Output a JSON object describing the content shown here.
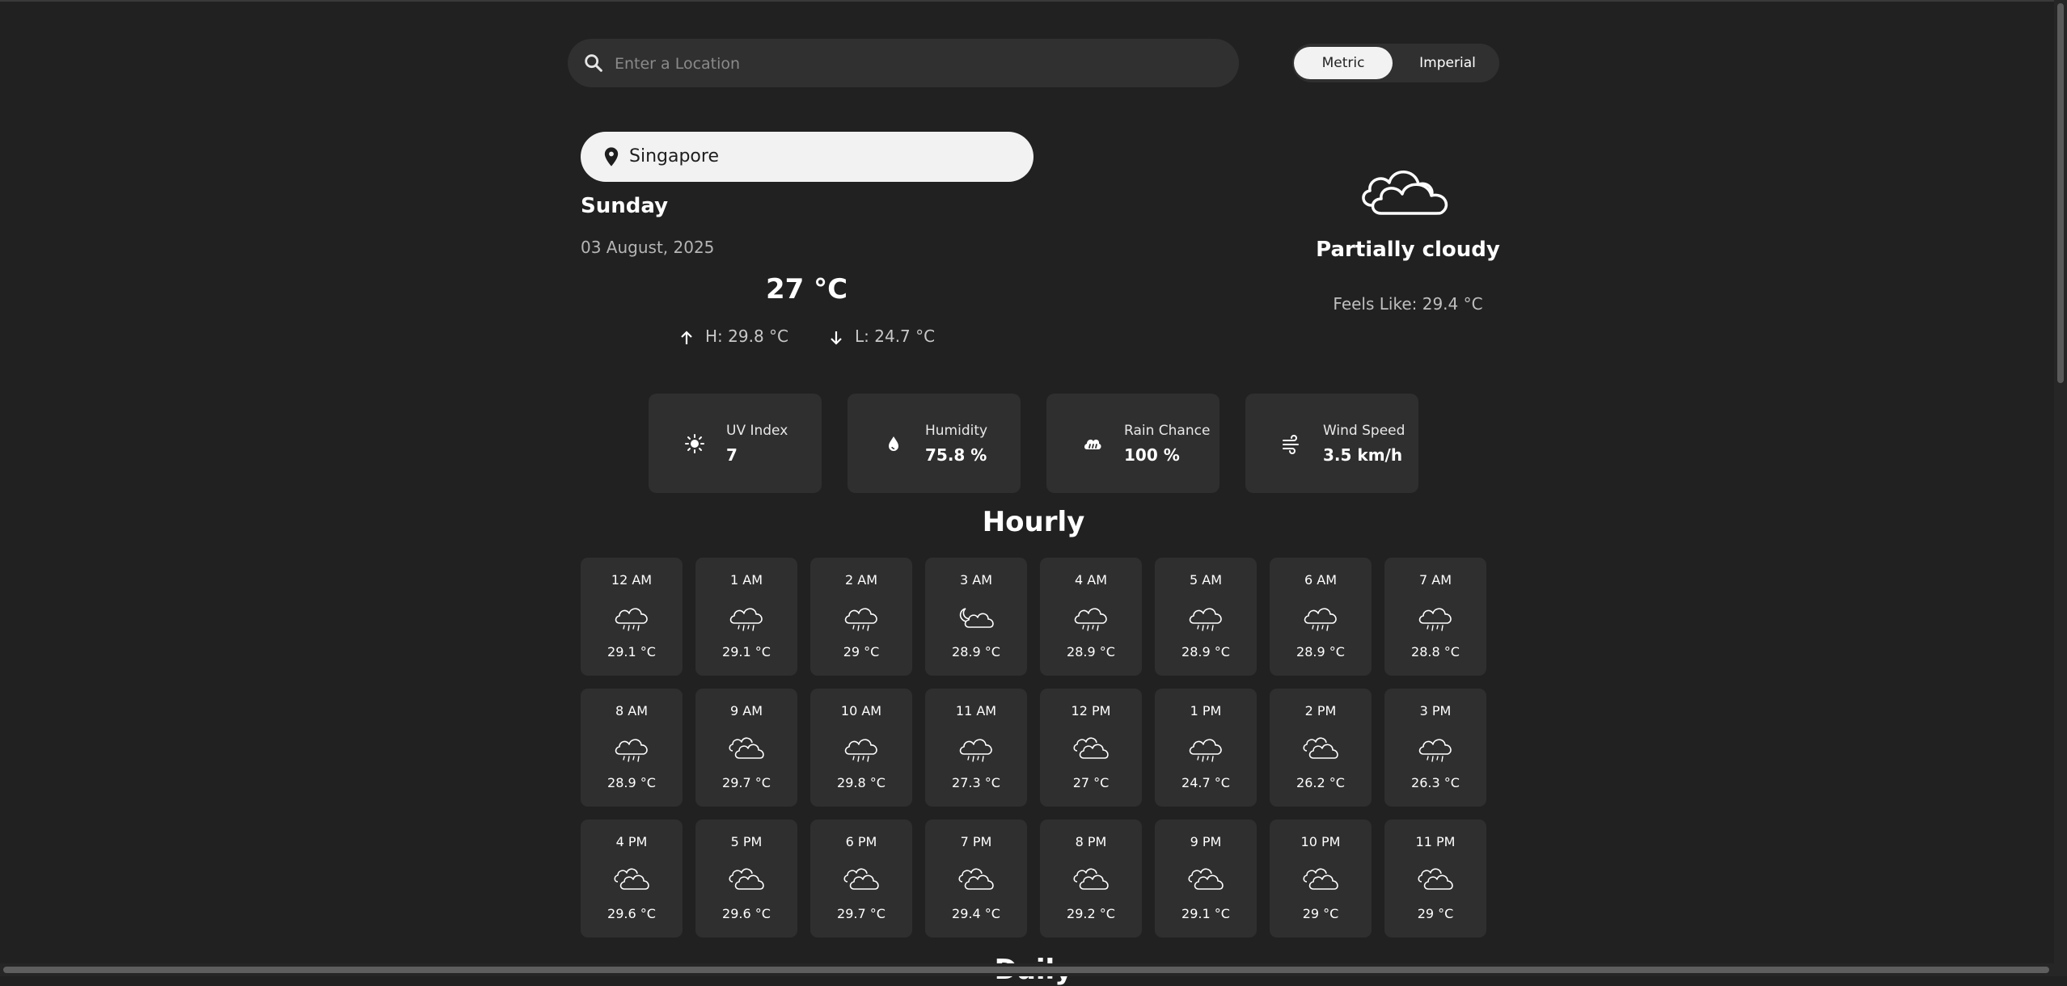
{
  "search": {
    "placeholder": "Enter a Location",
    "value": ""
  },
  "units": {
    "metric": "Metric",
    "imperial": "Imperial",
    "selected": "Metric"
  },
  "location": {
    "name": "Singapore",
    "icon": "location-pin-icon"
  },
  "current": {
    "day": "Sunday",
    "date": "03 August, 2025",
    "temp": "27 °C",
    "high": "H: 29.8 °C",
    "low": "L: 24.7 °C",
    "condition": "Partially cloudy",
    "condition_icon": "partly-cloudy-icon",
    "feels_like": "Feels Like: 29.4 °C"
  },
  "stats": [
    {
      "label": "UV Index",
      "value": "7",
      "icon": "sun-icon"
    },
    {
      "label": "Humidity",
      "value": "75.8 %",
      "icon": "droplet-icon"
    },
    {
      "label": "Rain Chance",
      "value": "100 %",
      "icon": "rain-cloud-icon"
    },
    {
      "label": "Wind Speed",
      "value": "3.5 km/h",
      "icon": "wind-icon"
    }
  ],
  "hourly_title": "Hourly",
  "hourly": [
    {
      "time": "12 AM",
      "temp": "29.1 °C",
      "icon": "rain"
    },
    {
      "time": "1 AM",
      "temp": "29.1 °C",
      "icon": "rain"
    },
    {
      "time": "2 AM",
      "temp": "29 °C",
      "icon": "rain"
    },
    {
      "time": "3 AM",
      "temp": "28.9 °C",
      "icon": "cloudy-night"
    },
    {
      "time": "4 AM",
      "temp": "28.9 °C",
      "icon": "rain"
    },
    {
      "time": "5 AM",
      "temp": "28.9 °C",
      "icon": "rain"
    },
    {
      "time": "6 AM",
      "temp": "28.9 °C",
      "icon": "rain"
    },
    {
      "time": "7 AM",
      "temp": "28.8 °C",
      "icon": "rain"
    },
    {
      "time": "8 AM",
      "temp": "28.9 °C",
      "icon": "rain"
    },
    {
      "time": "9 AM",
      "temp": "29.7 °C",
      "icon": "cloudy"
    },
    {
      "time": "10 AM",
      "temp": "29.8 °C",
      "icon": "rain"
    },
    {
      "time": "11 AM",
      "temp": "27.3 °C",
      "icon": "rain"
    },
    {
      "time": "12 PM",
      "temp": "27 °C",
      "icon": "cloudy"
    },
    {
      "time": "1 PM",
      "temp": "24.7 °C",
      "icon": "rain"
    },
    {
      "time": "2 PM",
      "temp": "26.2 °C",
      "icon": "cloudy"
    },
    {
      "time": "3 PM",
      "temp": "26.3 °C",
      "icon": "rain"
    },
    {
      "time": "4 PM",
      "temp": "29.6 °C",
      "icon": "cloudy"
    },
    {
      "time": "5 PM",
      "temp": "29.6 °C",
      "icon": "cloudy"
    },
    {
      "time": "6 PM",
      "temp": "29.7 °C",
      "icon": "cloudy"
    },
    {
      "time": "7 PM",
      "temp": "29.4 °C",
      "icon": "cloudy"
    },
    {
      "time": "8 PM",
      "temp": "29.2 °C",
      "icon": "cloudy"
    },
    {
      "time": "9 PM",
      "temp": "29.1 °C",
      "icon": "cloudy"
    },
    {
      "time": "10 PM",
      "temp": "29 °C",
      "icon": "cloudy"
    },
    {
      "time": "11 PM",
      "temp": "29 °C",
      "icon": "cloudy"
    }
  ],
  "daily_title": "Daily"
}
